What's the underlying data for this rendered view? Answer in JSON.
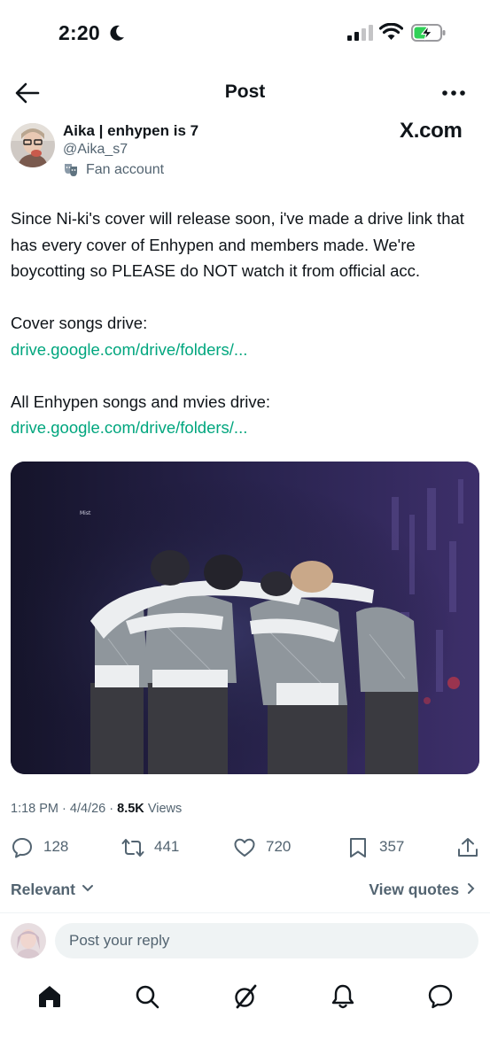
{
  "status_bar": {
    "time": "2:20",
    "icons": [
      "moon-icon",
      "cellular-signal-icon",
      "wifi-icon",
      "battery-charging-icon"
    ]
  },
  "header": {
    "title": "Post",
    "back_icon": "arrow-left-icon",
    "more_icon": "ellipsis-icon"
  },
  "author": {
    "name": "Aika | enhypen is 7",
    "handle": "@Aika_s7",
    "label": "Fan account",
    "label_icon": "masks-icon"
  },
  "source_badge": "X.com",
  "post": {
    "text": "Since Ni-ki's cover will release soon, i've made a drive link that has every cover of Enhypen and members made. We're boycotting so PLEASE do NOT watch it from official acc.",
    "section1_label": "Cover songs drive:",
    "section1_link": "drive.google.com/drive/folders/...",
    "section2_label": "All Enhypen songs and mvies drive:",
    "section2_link": "drive.google.com/drive/folders/..."
  },
  "meta": {
    "time": "1:18 PM",
    "separator": "·",
    "date": "4/4/26",
    "views_count": "8.5K",
    "views_label": "Views"
  },
  "actions": {
    "replies": "128",
    "reposts": "441",
    "likes": "720",
    "bookmarks": "357"
  },
  "sort": {
    "label": "Relevant",
    "view_quotes": "View quotes"
  },
  "reply": {
    "placeholder": "Post your reply"
  },
  "nav": [
    "home-icon",
    "search-icon",
    "grok-icon",
    "notifications-bell-icon",
    "messages-icon"
  ],
  "colors": {
    "link": "#00a67e",
    "secondary_text": "#536471",
    "primary_text": "#0f1419",
    "reply_field_bg": "#eff3f4",
    "battery_fill": "#30d158"
  }
}
